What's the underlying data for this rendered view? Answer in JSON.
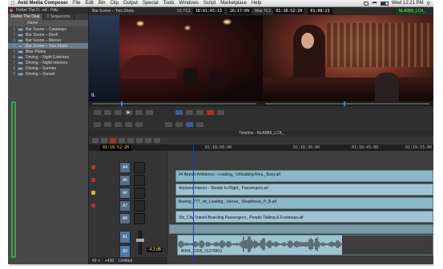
{
  "menubar": {
    "apple": "",
    "app": "Avid Media Composer",
    "items": [
      "File",
      "Edit",
      "Bin",
      "Clip",
      "Output",
      "Special",
      "Tools",
      "Windows",
      "Script",
      "Marketplace",
      "Help"
    ],
    "clock": "Wed 12:21 PM"
  },
  "window_title": "Composer",
  "bin": {
    "title": "Fisher The D...ed - Hiltz",
    "tabs": [
      "Fisher The Deal",
      "1 Sequences"
    ],
    "column_header": "Name",
    "rows": [
      {
        "n": "1",
        "name": "Bar Scene – Cutaways"
      },
      {
        "n": "2",
        "name": "Bar Scene – Devil"
      },
      {
        "n": "3",
        "name": "Bar Scene – Mercer"
      },
      {
        "n": "4",
        "name": "Bar Scene – Two Shots"
      },
      {
        "n": "5",
        "name": "Blue Plates"
      },
      {
        "n": "6",
        "name": "Driving – Night Exteriors"
      },
      {
        "n": "7",
        "name": "Driving – Night Interiors"
      },
      {
        "n": "8",
        "name": "Driving – Sunrise"
      },
      {
        "n": "9",
        "name": "Driving – Sunset"
      }
    ],
    "selected_index": 3
  },
  "monitors": {
    "source_name": "Bar Scene – Two Shots",
    "tc_label_1": "V1 TC1",
    "tc_value_1": "18:41:45:13",
    "tc_value_2": "26:17:09",
    "tc_label_2": "Mas TC1",
    "tc_value_3": "01:18:52:20",
    "tc_value_4": "01:08:23",
    "record_tag": "NLA0B6_LC4_",
    "source_label": "IL"
  },
  "timeline": {
    "title": "Timeline - NLA0B6_LC4_",
    "current_tc": "01:18:52:20",
    "ticks": [
      "01:18:00:00",
      "01:18:30:00",
      "01:18:45:00",
      "01:19:15:00"
    ],
    "tracks": [
      "A4",
      "A5",
      "A6",
      "A7",
      "A8",
      "A1",
      "A2"
    ],
    "clips": [
      {
        "label": "04 Airport Ambience - Loading_ Unloading Area_ Busy.aif",
        "row": 1
      },
      {
        "label": "Airplane Interior - Steady In Flight_ Passengers.aif",
        "row": 2
      },
      {
        "label": "Boeing_777_int_Loading_ Voices_ Steadiness_P_B.aif",
        "row": 3
      },
      {
        "label": "Sfx_City Transit Boarding Passengers_ People Talking & Footsteps.aif",
        "row": 4
      }
    ],
    "audio_caption": "B004_C005_0127RKQ",
    "level_db": "-4.3 dB",
    "bottom_labels": [
      "42 +",
      "+430",
      "Untitled"
    ]
  },
  "colors": {
    "accent_blue": "#2038c8",
    "clip_fill": "#8bb7c6",
    "timecode_yellow": "#ffe14d",
    "bin_selection": "#6c7a8c",
    "green_outline": "#3fa64a"
  },
  "icons": [
    "apple-icon",
    "wifi-icon",
    "battery-icon",
    "search-icon",
    "play-icon",
    "record-icon"
  ]
}
